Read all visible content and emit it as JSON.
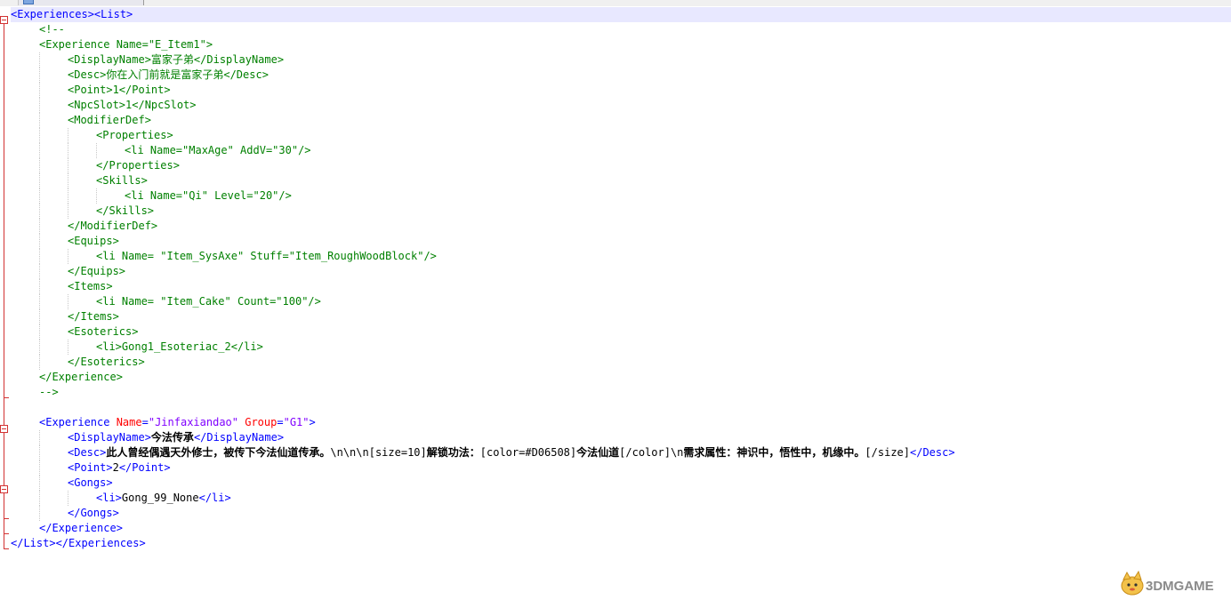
{
  "editor": {
    "tab": {
      "active": true
    },
    "lines": [
      [
        {
          "t": "<Experiences><List>",
          "c": "tag"
        }
      ],
      [
        {
          "t": "<!--",
          "c": "com"
        }
      ],
      [
        {
          "t": "<Experience Name=\"E_Item1\">",
          "c": "com"
        }
      ],
      [
        {
          "t": "<DisplayName>富家子弟</DisplayName>",
          "c": "com"
        }
      ],
      [
        {
          "t": "<Desc>你在入门前就是富家子弟</Desc>",
          "c": "com"
        }
      ],
      [
        {
          "t": "<Point>1</Point>",
          "c": "com"
        }
      ],
      [
        {
          "t": "<NpcSlot>1</NpcSlot>",
          "c": "com"
        }
      ],
      [
        {
          "t": "<ModifierDef>",
          "c": "com"
        }
      ],
      [
        {
          "t": "<Properties>",
          "c": "com"
        }
      ],
      [
        {
          "t": "<li Name=\"MaxAge\" AddV=\"30\"/>",
          "c": "com"
        }
      ],
      [
        {
          "t": "</Properties>",
          "c": "com"
        }
      ],
      [
        {
          "t": "<Skills>",
          "c": "com"
        }
      ],
      [
        {
          "t": "<li Name=\"Qi\" Level=\"20\"/>",
          "c": "com"
        }
      ],
      [
        {
          "t": "</Skills>",
          "c": "com"
        }
      ],
      [
        {
          "t": "</ModifierDef>",
          "c": "com"
        }
      ],
      [
        {
          "t": "<Equips>",
          "c": "com"
        }
      ],
      [
        {
          "t": "<li Name= \"Item_SysAxe\" Stuff=\"Item_RoughWoodBlock\"/>",
          "c": "com"
        }
      ],
      [
        {
          "t": "</Equips>",
          "c": "com"
        }
      ],
      [
        {
          "t": "<Items>",
          "c": "com"
        }
      ],
      [
        {
          "t": "<li Name= \"Item_Cake\" Count=\"100\"/>",
          "c": "com"
        }
      ],
      [
        {
          "t": "</Items>",
          "c": "com"
        }
      ],
      [
        {
          "t": "<Esoterics>",
          "c": "com"
        }
      ],
      [
        {
          "t": "<li>Gong1_Esoteriac_2</li>",
          "c": "com"
        }
      ],
      [
        {
          "t": "</Esoterics>",
          "c": "com"
        }
      ],
      [
        {
          "t": "</Experience>",
          "c": "com"
        }
      ],
      [
        {
          "t": "-->",
          "c": "com"
        }
      ],
      [],
      [
        {
          "t": "<Experience ",
          "c": "tag"
        },
        {
          "t": "Name",
          "c": "attr"
        },
        {
          "t": "=",
          "c": "tag"
        },
        {
          "t": "\"Jinfaxiandao\"",
          "c": "val"
        },
        {
          "t": " ",
          "c": "tag"
        },
        {
          "t": "Group",
          "c": "attr"
        },
        {
          "t": "=",
          "c": "tag"
        },
        {
          "t": "\"G1\"",
          "c": "val"
        },
        {
          "t": ">",
          "c": "tag"
        }
      ],
      [
        {
          "t": "<DisplayName>",
          "c": "tag"
        },
        {
          "t": "今法传承",
          "c": "bold"
        },
        {
          "t": "</DisplayName>",
          "c": "tag"
        }
      ],
      [
        {
          "t": "<Desc>",
          "c": "tag"
        },
        {
          "t": "此人曾经偶遇天外修士，被传下今法仙道传承。",
          "c": "bold"
        },
        {
          "t": "\\n\\n\\n[size=10]",
          "c": "txt"
        },
        {
          "t": "解锁功法：",
          "c": "bold"
        },
        {
          "t": "[color=#D06508]",
          "c": "txt"
        },
        {
          "t": "今法仙道",
          "c": "bold"
        },
        {
          "t": "[/color]\\n",
          "c": "txt"
        },
        {
          "t": "需求属性：神识中，悟性中，机缘中。",
          "c": "bold"
        },
        {
          "t": "[/size]",
          "c": "txt"
        },
        {
          "t": "</Desc>",
          "c": "tag"
        }
      ],
      [
        {
          "t": "<Point>",
          "c": "tag"
        },
        {
          "t": "2",
          "c": "txt"
        },
        {
          "t": "</Point>",
          "c": "tag"
        }
      ],
      [
        {
          "t": "<Gongs>",
          "c": "tag"
        }
      ],
      [
        {
          "t": "<li>",
          "c": "tag"
        },
        {
          "t": "Gong_99_None",
          "c": "txt"
        },
        {
          "t": "</li>",
          "c": "tag"
        }
      ],
      [
        {
          "t": "</Gongs>",
          "c": "tag"
        }
      ],
      [
        {
          "t": "</Experience>",
          "c": "tag"
        }
      ],
      [
        {
          "t": "</List></Experiences>",
          "c": "tag"
        }
      ]
    ],
    "indent_levels": [
      0,
      1,
      1,
      2,
      2,
      2,
      2,
      2,
      3,
      4,
      3,
      3,
      4,
      3,
      2,
      2,
      3,
      2,
      2,
      3,
      2,
      2,
      3,
      2,
      1,
      1,
      0,
      1,
      2,
      2,
      2,
      2,
      3,
      2,
      1,
      0
    ],
    "colors": {
      "tag": "#0000ff",
      "text": "#000000",
      "comment": "#008000",
      "attribute": "#ff0000",
      "value": "#8000ff",
      "current_line": "#e8e8ff",
      "fold_marker": "#d23232"
    }
  },
  "watermark": {
    "logo_icon": "mascot-icon",
    "text": "3DMGAME"
  }
}
